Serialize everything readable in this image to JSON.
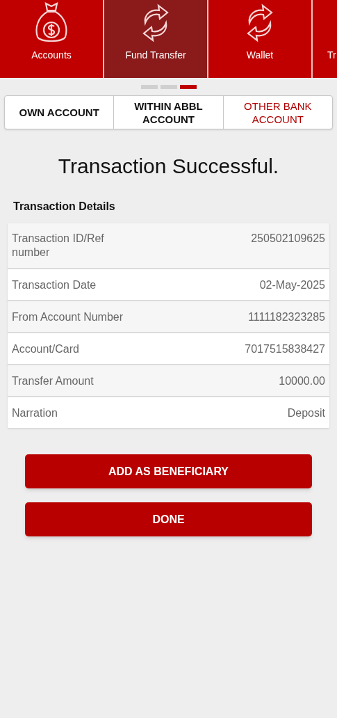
{
  "nav": [
    {
      "label": "Accounts",
      "kind": "bag",
      "selected": false
    },
    {
      "label": "Fund Transfer",
      "kind": "transfer",
      "selected": true
    },
    {
      "label": "Wallet",
      "kind": "transfer",
      "selected": false
    },
    {
      "label": "Tr",
      "kind": "cut",
      "selected": false
    }
  ],
  "pager": [
    {
      "selected": false
    },
    {
      "selected": false
    },
    {
      "selected": true
    }
  ],
  "tabs": [
    {
      "label": "OWN ACCOUNT",
      "selected": false
    },
    {
      "label": "WITHIN ABBL ACCOUNT",
      "selected": false
    },
    {
      "label": "OTHER BANK ACCOUNT",
      "selected": true
    }
  ],
  "heading": "Transaction Successful.",
  "details_title": "Transaction Details",
  "details": [
    {
      "label": "Transaction ID/Ref number",
      "value": "250502109625"
    },
    {
      "label": "Transaction Date",
      "value": "02-May-2025"
    },
    {
      "label": "From Account Number",
      "value": "1111182323285"
    },
    {
      "label": "Account/Card",
      "value": "7017515838427"
    },
    {
      "label": "Transfer Amount",
      "value": "10000.00"
    },
    {
      "label": "Narration",
      "value": "Deposit"
    }
  ],
  "buttons": [
    "ADD AS BENEFICIARY",
    "DONE"
  ]
}
